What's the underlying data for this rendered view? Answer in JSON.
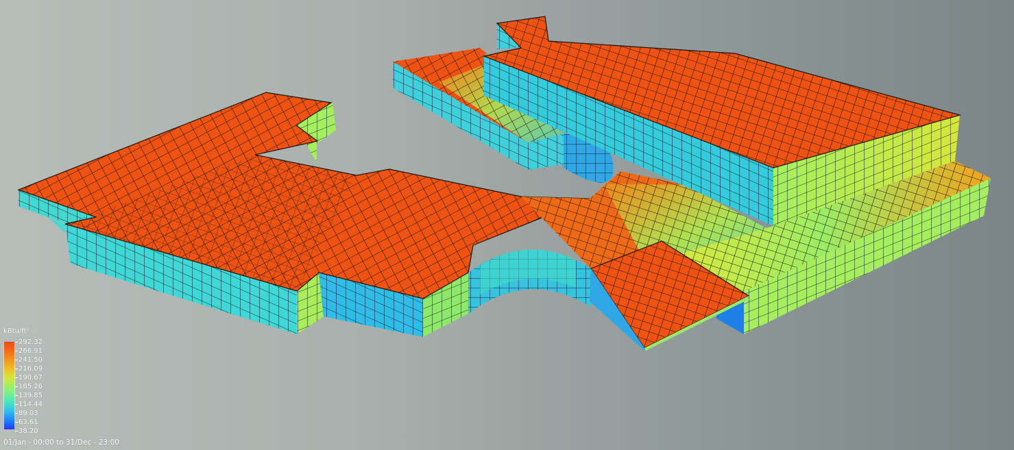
{
  "legend": {
    "unit": "kBtu/ft²",
    "ticks": [
      "292.32",
      "266.91",
      "241.50",
      "216.09",
      "190.67",
      "165.26",
      "139.85",
      "114.44",
      "89.03",
      "63.61",
      "38.20"
    ]
  },
  "period": "01/Jan - 00:00 to 31/Dec - 23:00",
  "colors": {
    "roof": "#ef5314",
    "wall_cyan": "#38d6da",
    "wall_green": "#8ee86a",
    "wall_blue": "#1f9ff0",
    "grid_line": "#111111"
  },
  "icons": {
    "model": "building-heat-map-icon"
  }
}
